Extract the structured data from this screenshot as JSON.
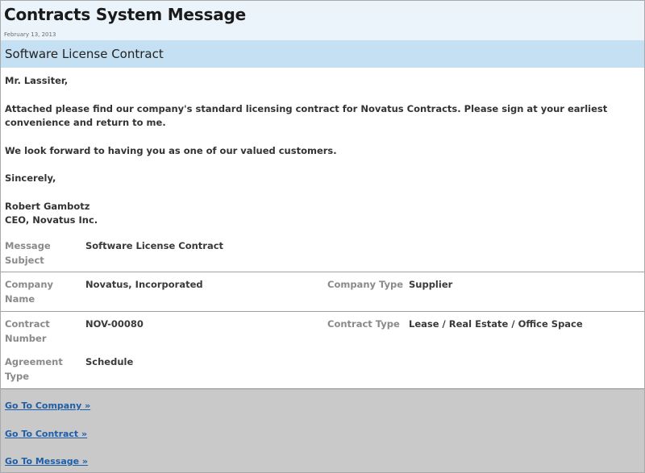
{
  "header": {
    "title": "Contracts System Message",
    "date": "February 13, 2013"
  },
  "subject_bar": "Software License Contract",
  "message": {
    "greeting": "Mr. Lassiter,",
    "paragraph1": "Attached please find our company's standard licensing contract for Novatus Contracts. Please sign at your earliest convenience and return to me.",
    "paragraph2": "We look forward to having you as one of our valued customers.",
    "closing": "Sincerely,",
    "signature_name": "Robert Gambotz",
    "signature_title": "CEO, Novatus Inc."
  },
  "fields": {
    "message_subject": {
      "label": "Message Subject",
      "value": "Software License Contract"
    },
    "company_name": {
      "label": "Company Name",
      "value": "Novatus, Incorporated"
    },
    "company_type": {
      "label": "Company Type",
      "value": "Supplier"
    },
    "contract_number": {
      "label": "Contract Number",
      "value": "NOV-00080"
    },
    "contract_type": {
      "label": "Contract Type",
      "value": "Lease / Real Estate / Office Space"
    },
    "agreement_type": {
      "label": "Agreement Type",
      "value": "Schedule"
    }
  },
  "links": {
    "company": "Go To Company »",
    "contract": "Go To Contract »",
    "message": "Go To Message »"
  },
  "colors": {
    "header_bg": "#ebf3fb",
    "subject_bar_bg": "#c5e0f2",
    "links_bg": "#c9c9c9",
    "link_color": "#1f5ea8"
  }
}
